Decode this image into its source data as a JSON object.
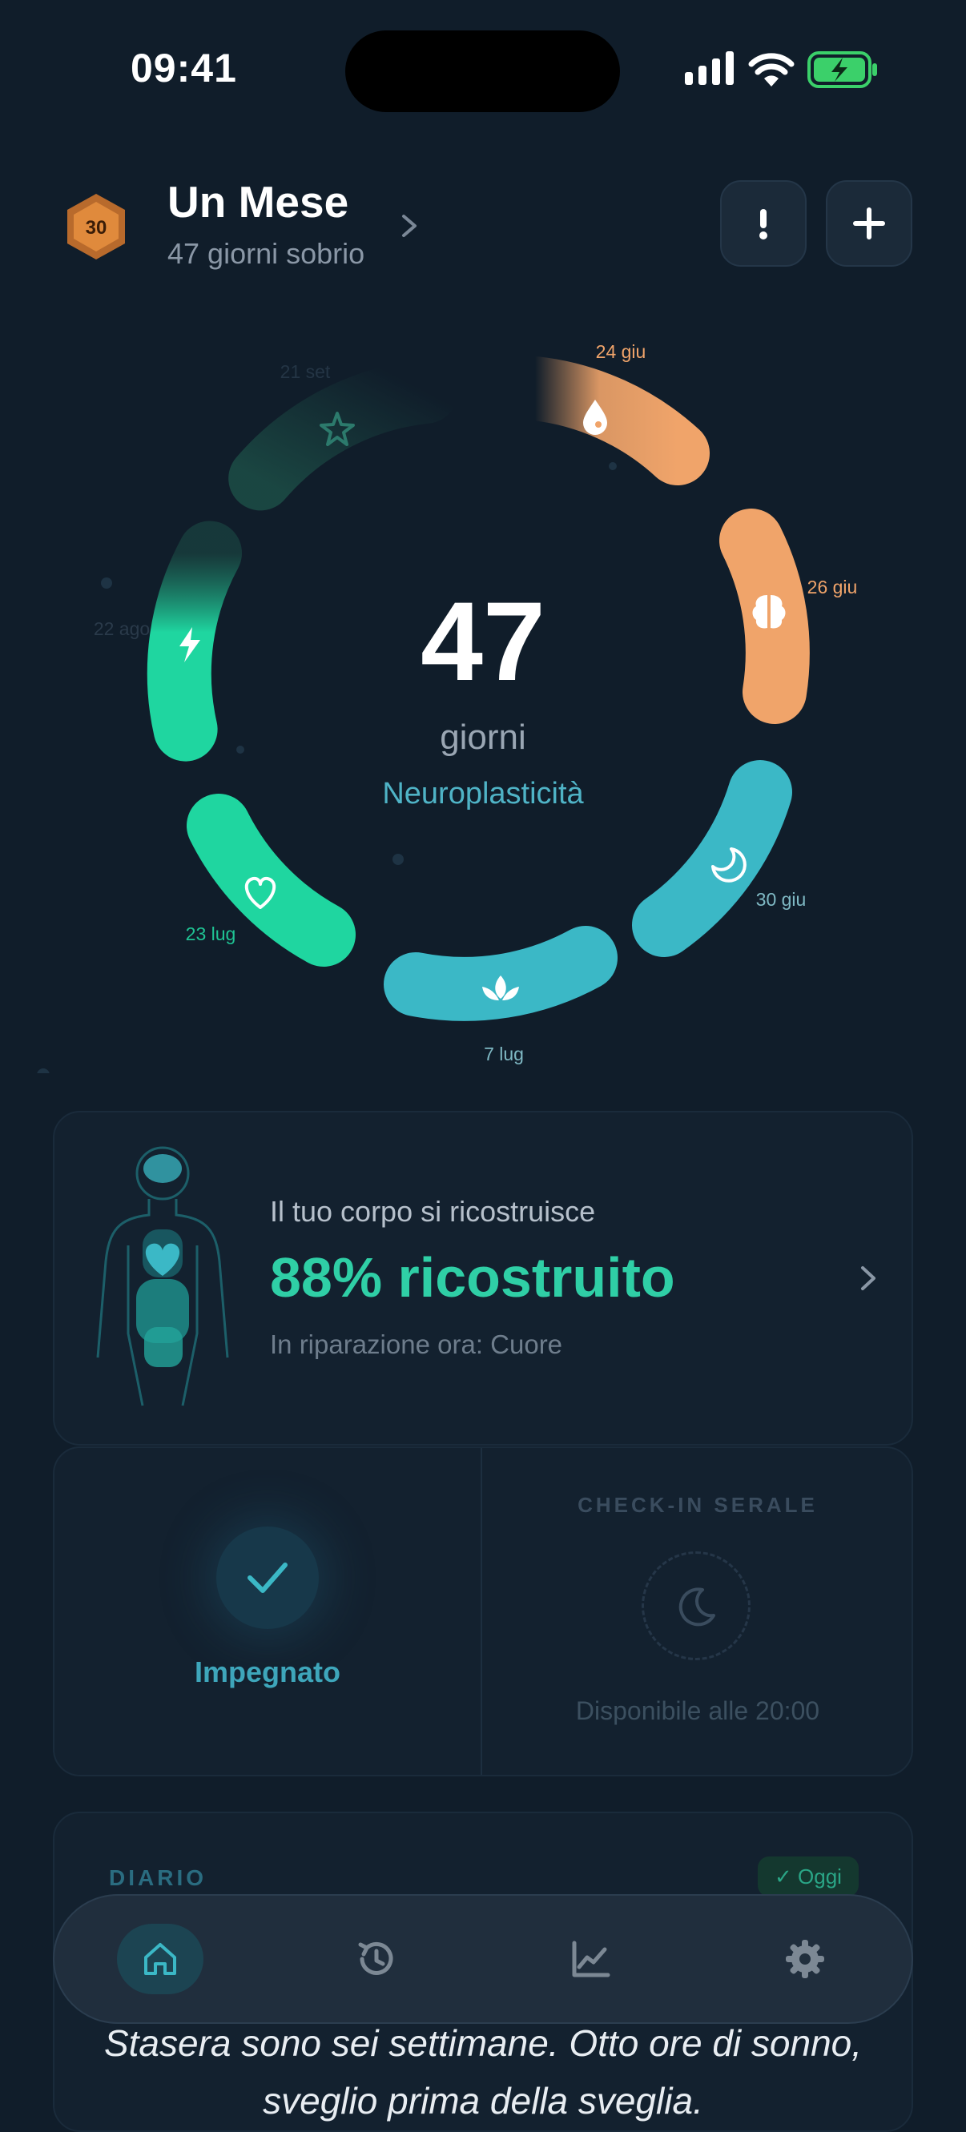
{
  "status_bar": {
    "time": "09:41"
  },
  "header": {
    "badge_number": "30",
    "title": "Un Mese",
    "subtitle": "47 giorni sobrio"
  },
  "ring": {
    "days_count": "47",
    "days_unit": "giorni",
    "current_phase": "Neuroplasticità",
    "milestones": [
      {
        "date": "23 lug",
        "icon": "heart-icon",
        "color": "#1fd6a0"
      },
      {
        "date": "7 lug",
        "icon": "lotus-icon",
        "color": "#3bb8c6"
      },
      {
        "date": "30 giu",
        "icon": "moon-icon",
        "color": "#3bb8c6"
      },
      {
        "date": "26 giu",
        "icon": "brain-icon",
        "color": "#f0a46a"
      },
      {
        "date": "24 giu",
        "icon": "drop-icon",
        "color": "#f0a46a"
      },
      {
        "date": "21 set",
        "icon": "star-icon",
        "color": "#1b4a44"
      },
      {
        "date": "22 ago",
        "icon": "bolt-icon",
        "color": "#1fd6a0"
      }
    ]
  },
  "body_card": {
    "pretitle": "Il tuo corpo si ricostruisce",
    "percent_label": "88% ricostruito",
    "repair_label": "In riparazione ora: Cuore"
  },
  "commit_card": {
    "label": "Impegnato",
    "checkin_title": "CHECK-IN SERALE",
    "checkin_available": "Disponibile alle 20:00"
  },
  "diary": {
    "label": "DIARIO",
    "today_badge": "✓ Oggi",
    "text": "Stasera sono sei settimane. Otto ore di sonno, sveglio prima della sveglia."
  },
  "tabbar": {
    "tabs": [
      {
        "name": "home",
        "icon": "home-icon",
        "active": true
      },
      {
        "name": "history",
        "icon": "history-icon",
        "active": false
      },
      {
        "name": "stats",
        "icon": "chart-icon",
        "active": false
      },
      {
        "name": "settings",
        "icon": "gear-icon",
        "active": false
      }
    ]
  },
  "colors": {
    "background": "#101d2a",
    "teal": "#3bb8c6",
    "green": "#1fd6a0",
    "orange": "#f0a46a"
  }
}
